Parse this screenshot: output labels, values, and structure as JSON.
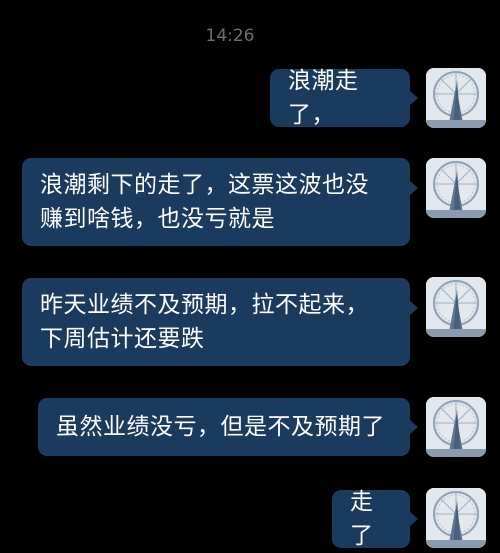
{
  "status": {
    "timestamp": "14:26"
  },
  "messages": [
    {
      "text": "浪潮走了，"
    },
    {
      "text": "浪潮剩下的走了，这票这波也没\n赚到啥钱，也没亏就是"
    },
    {
      "text": "昨天业绩不及预期，拉不起来，\n下周估计还要跌"
    },
    {
      "text": "虽然业绩没亏，但是不及预期了"
    },
    {
      "text": "走了"
    }
  ],
  "avatar": {
    "icon": "ferris-wheel-avatar-icon"
  },
  "colors": {
    "background": "#000000",
    "bubble": "#1a3a5e",
    "text": "#ffffff",
    "timestamp": "#6e6e73"
  }
}
